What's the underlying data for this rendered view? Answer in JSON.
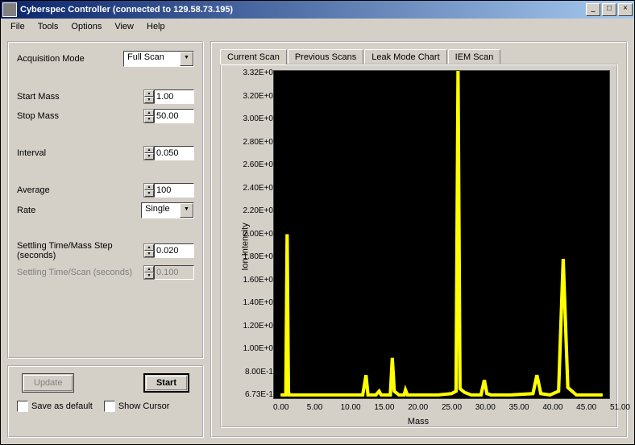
{
  "window": {
    "title": "Cyberspec Controller (connected to 129.58.73.195)"
  },
  "menubar": [
    "File",
    "Tools",
    "Options",
    "View",
    "Help"
  ],
  "acquisition": {
    "mode_label": "Acquisition Mode",
    "mode_value": "Full Scan",
    "start_mass_label": "Start Mass",
    "start_mass": "1.00",
    "stop_mass_label": "Stop Mass",
    "stop_mass": "50.00",
    "interval_label": "Interval",
    "interval": "0.050",
    "average_label": "Average",
    "average": "100",
    "rate_label": "Rate",
    "rate_value": "Single",
    "settling_step_label": "Settling Time/Mass Step (seconds)",
    "settling_step": "0.020",
    "settling_scan_label": "Settling Time/Scan (seconds)",
    "settling_scan": "0.100"
  },
  "actions": {
    "update": "Update",
    "start": "Start",
    "save_default": "Save as default",
    "show_cursor": "Show Cursor"
  },
  "tabs": [
    "Current Scan",
    "Previous Scans",
    "Leak Mode Chart",
    "IEM Scan"
  ],
  "chart_data": {
    "type": "line",
    "title": "",
    "xlabel": "Mass",
    "ylabel": "Ion Intensity",
    "xlim": [
      0,
      51
    ],
    "ylim": [
      0.673,
      3.32
    ],
    "yticks": [
      "3.32E+0",
      "3.20E+0",
      "3.00E+0",
      "2.80E+0",
      "2.60E+0",
      "2.40E+0",
      "2.20E+0",
      "2.00E+0",
      "1.80E+0",
      "1.60E+0",
      "1.40E+0",
      "1.20E+0",
      "1.00E+0",
      "8.00E-1",
      "6.73E-1"
    ],
    "xticks": [
      "0.00",
      "5.00",
      "10.00",
      "15.00",
      "20.00",
      "25.00",
      "30.00",
      "35.00",
      "40.00",
      "45.00",
      "51.00"
    ],
    "x": [
      1.0,
      1.3,
      1.8,
      2.0,
      2.2,
      2.3,
      2.5,
      4,
      10,
      13.5,
      14.0,
      14.3,
      15,
      15.5,
      16.0,
      16.3,
      17,
      17.7,
      18.0,
      18.3,
      19,
      19.8,
      20.0,
      20.3,
      21,
      25,
      27.0,
      27.7,
      28.0,
      28.3,
      29.0,
      30,
      31.5,
      32.0,
      32.4,
      33,
      36,
      39.4,
      40.0,
      40.6,
      42,
      43.3,
      44.0,
      44.7,
      46,
      50
    ],
    "values": [
      0.7,
      0.7,
      0.7,
      2.0,
      0.73,
      0.7,
      0.7,
      0.7,
      0.7,
      0.7,
      0.86,
      0.7,
      0.7,
      0.7,
      0.73,
      0.7,
      0.7,
      0.7,
      1.0,
      0.73,
      0.7,
      0.7,
      0.74,
      0.7,
      0.7,
      0.7,
      0.71,
      0.73,
      3.32,
      0.75,
      0.72,
      0.7,
      0.7,
      0.82,
      0.71,
      0.7,
      0.7,
      0.71,
      0.86,
      0.71,
      0.7,
      0.73,
      1.8,
      0.76,
      0.7,
      0.7
    ]
  }
}
